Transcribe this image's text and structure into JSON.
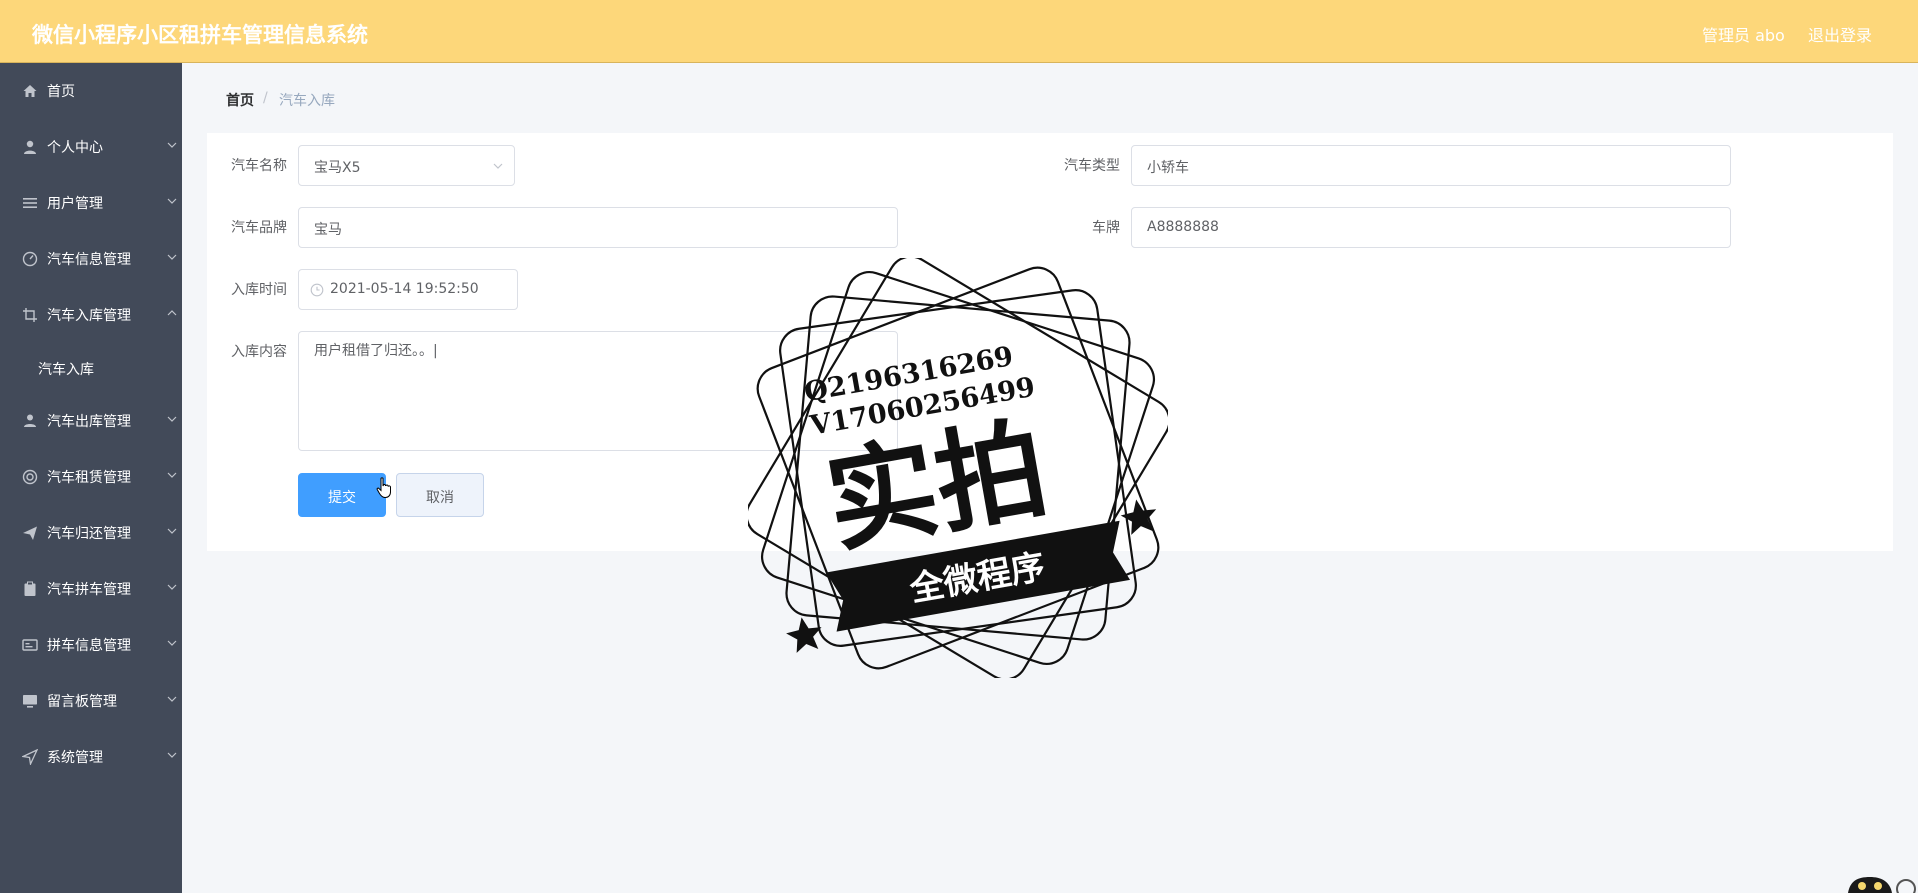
{
  "header": {
    "app_title": "微信小程序小区租拼车管理信息系统",
    "admin": "管理员 abo",
    "logout": "退出登录"
  },
  "sidebar": {
    "items": [
      {
        "label": "首页",
        "icon": "home-icon"
      },
      {
        "label": "个人中心",
        "icon": "user-icon"
      },
      {
        "label": "用户管理",
        "icon": "list-icon"
      },
      {
        "label": "汽车信息管理",
        "icon": "gauge-icon"
      },
      {
        "label": "汽车入库管理",
        "icon": "crop-icon"
      },
      {
        "label": "汽车出库管理",
        "icon": "person-icon"
      },
      {
        "label": "汽车租赁管理",
        "icon": "lifebuoy-icon"
      },
      {
        "label": "汽车归还管理",
        "icon": "send-icon"
      },
      {
        "label": "汽车拼车管理",
        "icon": "clipboard-icon"
      },
      {
        "label": "拼车信息管理",
        "icon": "card-icon"
      },
      {
        "label": "留言板管理",
        "icon": "monitor-icon"
      },
      {
        "label": "系统管理",
        "icon": "navigation-icon"
      }
    ],
    "subitem": "汽车入库"
  },
  "breadcrumb": {
    "home": "首页",
    "separator": "/",
    "current": "汽车入库"
  },
  "form": {
    "car_name_label": "汽车名称",
    "car_name_value": "宝马X5",
    "car_type_label": "汽车类型",
    "car_type_value": "小轿车",
    "car_brand_label": "汽车品牌",
    "car_brand_value": "宝马",
    "plate_label": "车牌",
    "plate_value": "A8888888",
    "in_time_label": "入库时间",
    "in_time_value": "2021-05-14 19:52:50",
    "content_label": "入库内容",
    "content_value": "用户租借了归还。。|",
    "submit_label": "提交",
    "cancel_label": "取消"
  },
  "watermark": {
    "line1": "Q2196316269",
    "line2": "V17060256499",
    "main": "实拍",
    "banner": "全微程序"
  },
  "colors": {
    "header_bg": "#fdd77a",
    "sidebar_bg": "#424a59",
    "primary": "#409eff",
    "page_bg": "#f4f6f9"
  }
}
